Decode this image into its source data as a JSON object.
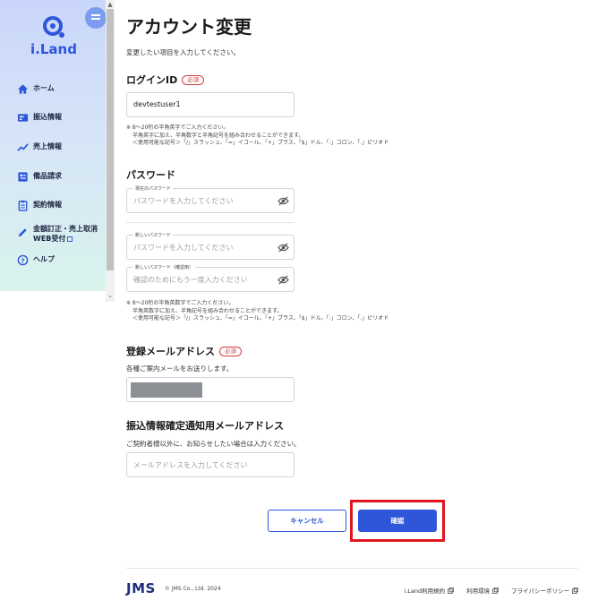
{
  "sidebar": {
    "logo_text": "i.Land",
    "menu_toggle_icon": "hamburger-icon",
    "items": [
      {
        "icon": "home-icon",
        "label": "ホーム"
      },
      {
        "icon": "payment-card-icon",
        "label": "振込情報"
      },
      {
        "icon": "trend-chart-icon",
        "label": "売上情報"
      },
      {
        "icon": "invoice-icon",
        "label": "備品請求"
      },
      {
        "icon": "clipboard-icon",
        "label": "契約情報"
      },
      {
        "icon": "pencil-icon",
        "label_line1": "金額訂正・売上取消",
        "label_line2": "WEB受付",
        "external": true
      },
      {
        "icon": "help-icon",
        "label": "ヘルプ"
      }
    ]
  },
  "page": {
    "title": "アカウント変更",
    "lead": "変更したい項目を入力してください。"
  },
  "login_id": {
    "title": "ログインID",
    "required_badge": "必須",
    "value": "devtestuser1",
    "note_line1": "※ 8〜20桁の半角英字でご入力ください。",
    "note_line2": "半角英字に加え、半角数字と半角記号を組み合わせることができます。",
    "note_line3": "＜使用可能な記号＞「/」スラッシュ、「=」イコール、「+」プラス、「$」ドル、「:」コロン、「.」ピリオド"
  },
  "password": {
    "title": "パスワード",
    "current_label": "現在のパスワード",
    "current_placeholder": "パスワードを入力してください",
    "new_label": "新しいパスワード",
    "new_placeholder": "パスワードを入力してください",
    "confirm_label": "新しいパスワード（確認用）",
    "confirm_placeholder": "確認のためにもう一度入力ください",
    "note_line1": "※ 8〜20桁の半角英数字でご入力ください。",
    "note_line2": "半角英数字に加え、半角記号を組み合わせることができます。",
    "note_line3": "＜使用可能な記号＞「/」スラッシュ、「=」イコール、「+」プラス、「$」ドル、「:」コロン、「.」ピリオド"
  },
  "email": {
    "title": "登録メールアドレス",
    "required_badge": "必須",
    "helper": "各種ご案内メールをお送りします。"
  },
  "notify_email": {
    "title": "振込情報確定通知用メールアドレス",
    "helper": "ご契約者様以外に、お知らせしたい場合は入力ください。",
    "placeholder": "メールアドレスを入力してください"
  },
  "actions": {
    "cancel_label": "キャンセル",
    "confirm_label": "確認"
  },
  "footer": {
    "logo": "JMS",
    "copyright": "© JMS Co., Ltd. 2024",
    "links": [
      "i.Land利用規約",
      "利用環境",
      "プライバシーポリシー"
    ]
  },
  "colors": {
    "accent": "#2f55d9",
    "required": "#d63b3b",
    "highlight": "#e0141e"
  }
}
